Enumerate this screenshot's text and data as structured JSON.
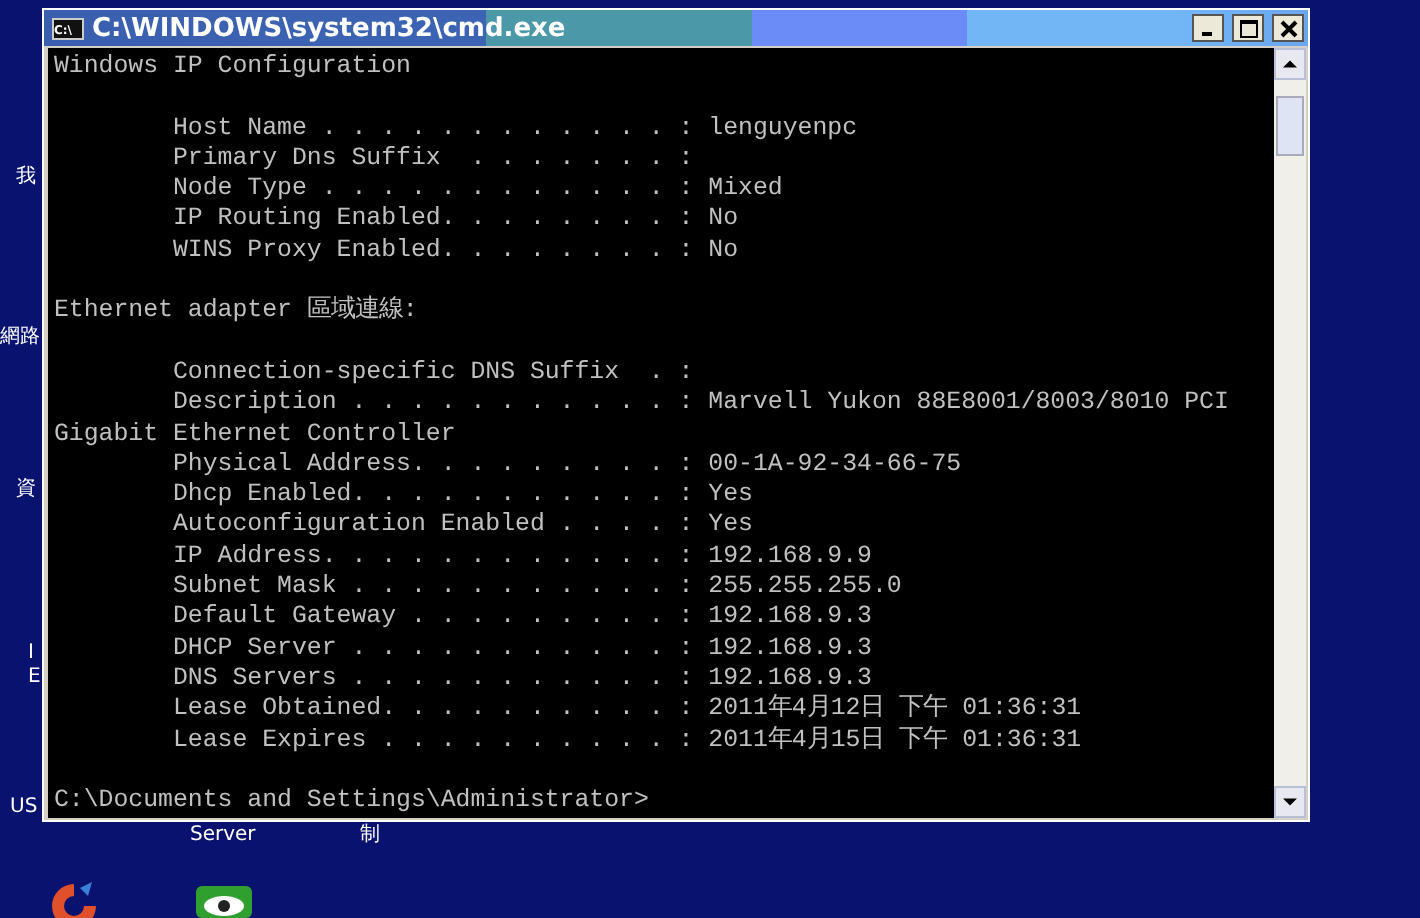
{
  "window": {
    "title": "C:\\WINDOWS\\system32\\cmd.exe",
    "icon_text": "C:\\"
  },
  "console": {
    "lines": [
      {
        "kind": "text",
        "text": "Windows IP Configuration"
      },
      {
        "kind": "blank"
      },
      {
        "kind": "text",
        "text": "        Host Name . . . . . . . . . . . . : lenguyenpc"
      },
      {
        "kind": "text",
        "text": "        Primary Dns Suffix  . . . . . . . : "
      },
      {
        "kind": "text",
        "text": "        Node Type . . . . . . . . . . . . : Mixed"
      },
      {
        "kind": "text",
        "text": "        IP Routing Enabled. . . . . . . . : No"
      },
      {
        "kind": "text",
        "text": "        WINS Proxy Enabled. . . . . . . . : No"
      },
      {
        "kind": "blank"
      },
      {
        "kind": "text",
        "text": "Ethernet adapter 區域連線:"
      },
      {
        "kind": "blank"
      },
      {
        "kind": "text",
        "text": "        Connection-specific DNS Suffix  . : "
      },
      {
        "kind": "text",
        "text": "        Description . . . . . . . . . . . : Marvell Yukon 88E8001/8003/8010 PCI"
      },
      {
        "kind": "text",
        "text": "Gigabit Ethernet Controller"
      },
      {
        "kind": "text",
        "text": "        Physical Address. . . . . . . . . : 00-1A-92-34-66-75"
      },
      {
        "kind": "text",
        "text": "        Dhcp Enabled. . . . . . . . . . . : Yes"
      },
      {
        "kind": "text",
        "text": "        Autoconfiguration Enabled . . . . : Yes"
      },
      {
        "kind": "text",
        "text": "        IP Address. . . . . . . . . . . . : 192.168.9.9"
      },
      {
        "kind": "text",
        "text": "        Subnet Mask . . . . . . . . . . . : 255.255.255.0"
      },
      {
        "kind": "text",
        "text": "        Default Gateway . . . . . . . . . : 192.168.9.3"
      },
      {
        "kind": "text",
        "text": "        DHCP Server . . . . . . . . . . . : 192.168.9.3"
      },
      {
        "kind": "text",
        "text": "        DNS Servers . . . . . . . . . . . : 192.168.9.3"
      },
      {
        "kind": "text",
        "text": "        Lease Obtained. . . . . . . . . . : 2011年4月12日 下午 01:36:31"
      },
      {
        "kind": "text",
        "text": "        Lease Expires . . . . . . . . . . : 2011年4月15日 下午 01:36:31"
      },
      {
        "kind": "blank"
      },
      {
        "kind": "text",
        "text": "C:\\Documents and Settings\\Administrator>"
      }
    ]
  },
  "desktop": {
    "labels": [
      "我",
      "網路",
      "資",
      "I",
      "E",
      "US",
      "Server",
      "制"
    ]
  }
}
